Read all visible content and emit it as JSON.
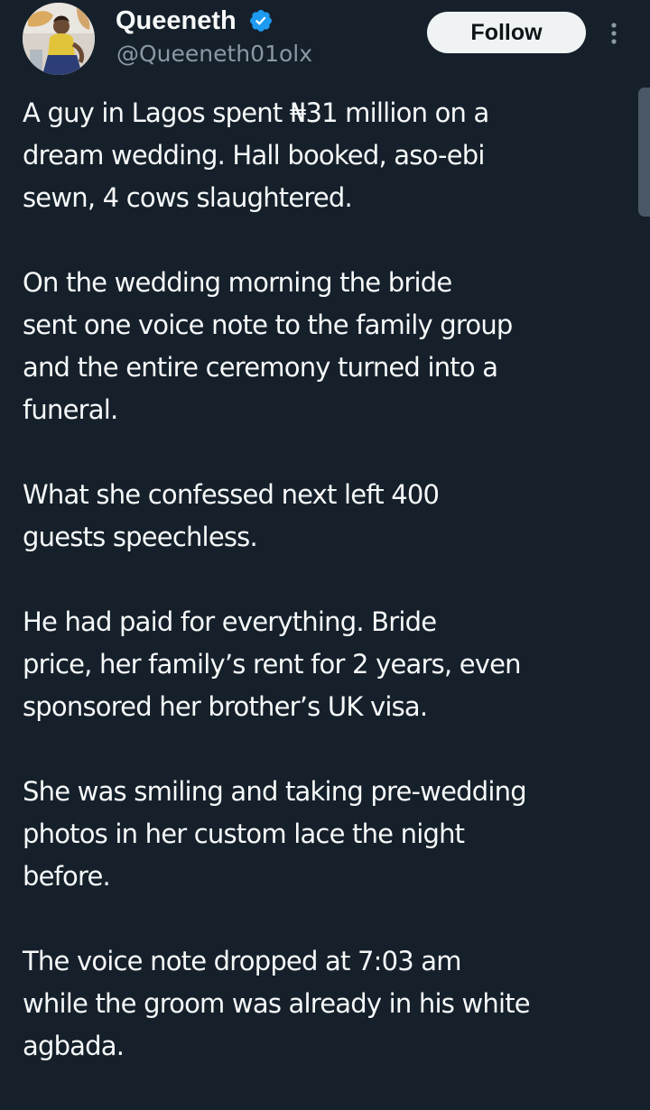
{
  "author": {
    "display_name": "Queeneth",
    "handle": "@Queeneth01olx",
    "verified": true,
    "avatar_icon": "profile-photo-icon"
  },
  "actions": {
    "follow_label": "Follow",
    "more_icon": "more-vertical-icon"
  },
  "colors": {
    "background": "#15202b",
    "text": "#f7f9f9",
    "secondary_text": "#8b98a5",
    "verified": "#1d9bf0",
    "follow_button_bg": "#eff3f4"
  },
  "tweet": {
    "paragraphs": [
      "A guy in Lagos spent ₦31 million on a\ndream wedding. Hall booked, aso-ebi\nsewn, 4 cows slaughtered.",
      "On the wedding morning the bride\nsent one voice note to the family group\nand the entire ceremony turned into a\nfuneral.",
      "What she confessed next left 400\nguests speechless.",
      "He had paid for everything. Bride\nprice, her family’s rent for 2 years, even\nsponsored her brother’s UK visa.",
      "She was smiling and taking pre-wedding\nphotos in her custom lace the night\nbefore.",
      "The voice note dropped at 7:03 am\nwhile the groom was already in his white\nagbada."
    ]
  }
}
